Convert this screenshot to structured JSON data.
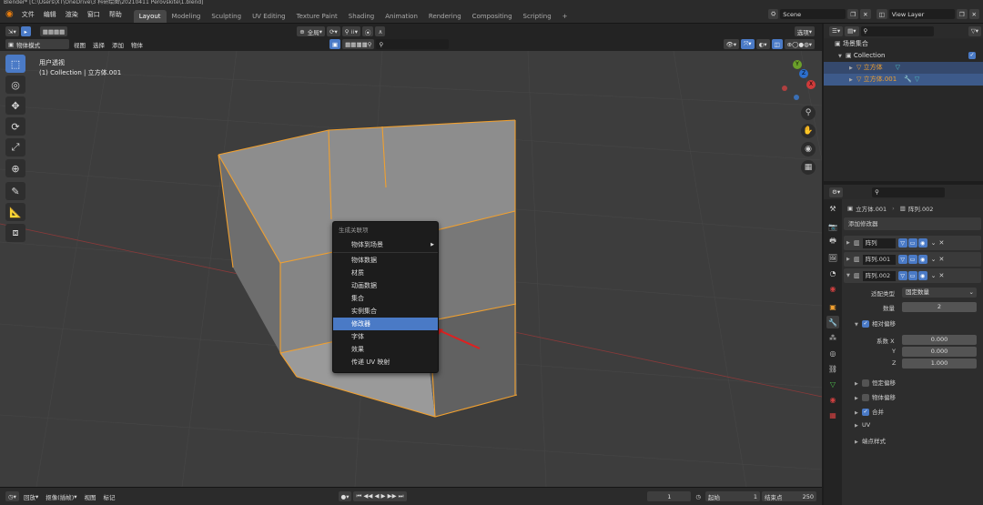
{
  "window": {
    "title": "Blender* [C:\\Users\\XT\\OneDrive\\3 科研绘图\\20210411 Perovskite\\1.blend]"
  },
  "menu": [
    "文件",
    "编辑",
    "渲染",
    "窗口",
    "帮助"
  ],
  "workspaces": [
    "Layout",
    "Modeling",
    "Sculpting",
    "UV Editing",
    "Texture Paint",
    "Shading",
    "Animation",
    "Rendering",
    "Compositing",
    "Scripting",
    "+"
  ],
  "scene": {
    "scene_label": "Scene",
    "view_layer": "View Layer"
  },
  "viewport_header": {
    "mode": "物体模式",
    "menus": [
      "视图",
      "选择",
      "添加",
      "物体"
    ],
    "transform": "全局",
    "options": "选项"
  },
  "viewport": {
    "perspective_label": "用户透视",
    "collection_label": "(1) Collection | 立方体.001",
    "gizmo": {
      "x": "X",
      "y": "Y",
      "z": "Z"
    }
  },
  "context_menu": {
    "title": "生成关联项",
    "items": [
      {
        "label": "物体到场景",
        "submenu": true
      },
      {
        "label": "物体数据"
      },
      {
        "label": "材质"
      },
      {
        "label": "动画数据"
      },
      {
        "label": "集合"
      },
      {
        "label": "实例集合"
      },
      {
        "label": "修改器",
        "highlighted": true
      },
      {
        "label": "字体"
      },
      {
        "label": "效果"
      },
      {
        "label": "传递 UV 映射"
      }
    ]
  },
  "outliner": {
    "root": "场景集合",
    "collection": "Collection",
    "objects": [
      "立方体",
      "立方体.001"
    ]
  },
  "properties": {
    "breadcrumb_object": "立方体.001",
    "breadcrumb_modifier": "阵列.002",
    "add_modifier": "添加修改器",
    "modifiers": [
      "阵列",
      "阵列.001",
      "阵列.002"
    ],
    "fit_type_label": "适配类型",
    "fit_type_value": "固定数量",
    "count_label": "数量",
    "count_value": "2",
    "relative_offset": "相对偏移",
    "factor_x_label": "系数 X",
    "factor_x": "0.000",
    "factor_y_label": "Y",
    "factor_y": "0.000",
    "factor_z_label": "Z",
    "factor_z": "1.000",
    "constant_offset": "恒定偏移",
    "object_offset": "物体偏移",
    "merge": "合并",
    "uv": "UV",
    "caps": "端点样式"
  },
  "timeline": {
    "playback": "回放",
    "keying": "抠像(插帧)",
    "view": "视图",
    "marker": "标记",
    "current_frame": "1",
    "start_label": "起始",
    "start": "1",
    "end_label": "结束点",
    "end": "250"
  },
  "colors": {
    "accent": "#4a7ac6",
    "select_outline": "#f0a030"
  }
}
